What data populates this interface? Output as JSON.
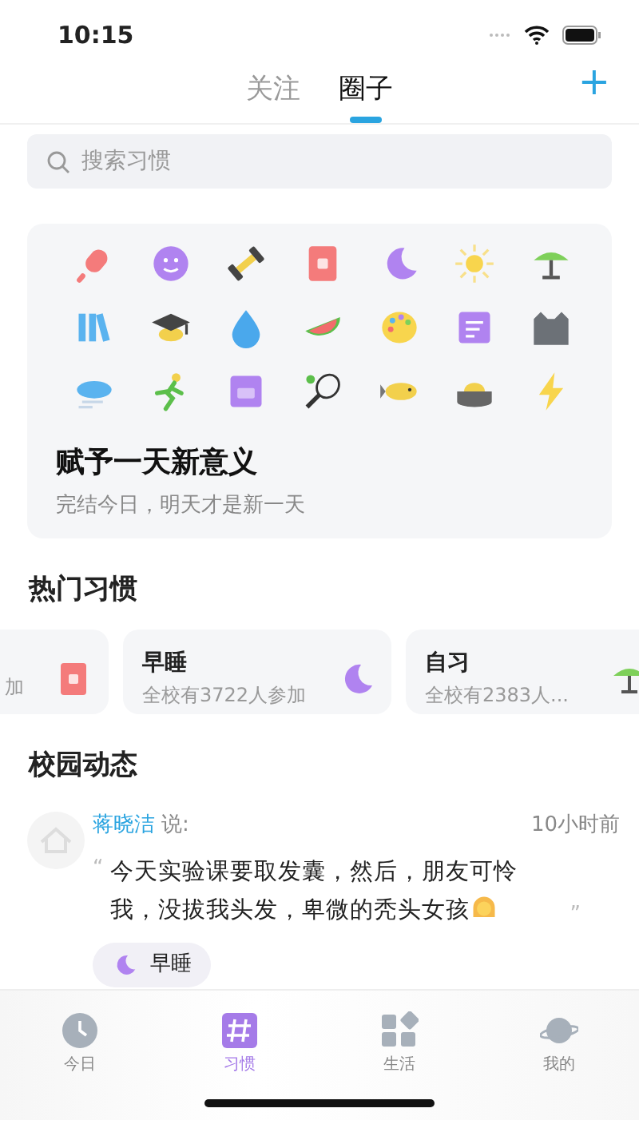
{
  "status_bar": {
    "time": "10:15"
  },
  "header": {
    "tabs": [
      {
        "label": "关注",
        "selected": false
      },
      {
        "label": "圈子",
        "selected": true
      }
    ],
    "add_button": "+"
  },
  "search": {
    "placeholder": "搜索习惯"
  },
  "banner": {
    "title": "赋予一天新意义",
    "subtitle": "完结今日，明天才是新一天"
  },
  "hot_habits": {
    "title": "热门习惯",
    "cards": [
      {
        "participants": "加"
      },
      {
        "name": "早睡",
        "participants": "全校有3722人参加"
      },
      {
        "name": "自习",
        "participants": "全校有2383人..."
      }
    ]
  },
  "feed": {
    "title": "校园动态",
    "posts": [
      {
        "author": "蒋晓洁",
        "says": "说:",
        "time": "10小时前",
        "open_quote": "“",
        "close_quote": "”",
        "text": "今天实验课要取发囊，然后，朋友可怜我，没拔我头发，卑微的秃头女孩",
        "tag": "早睡"
      }
    ]
  },
  "tab_bar": [
    {
      "label": "今日",
      "selected": false
    },
    {
      "label": "习惯",
      "selected": true
    },
    {
      "label": "生活",
      "selected": false
    },
    {
      "label": "我的",
      "selected": false
    }
  ]
}
